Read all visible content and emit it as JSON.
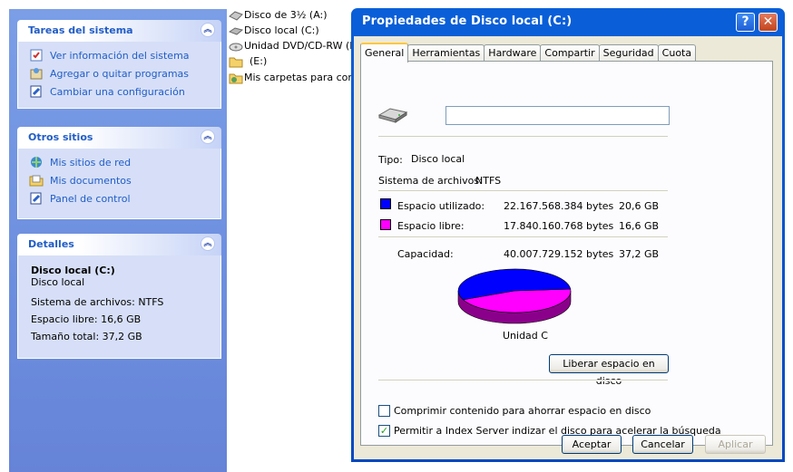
{
  "task_pane": {
    "system_tasks": {
      "title": "Tareas del sistema",
      "items": [
        {
          "label": "Ver información del sistema",
          "icon": "info-icon"
        },
        {
          "label": "Agregar o quitar programas",
          "icon": "add-remove-programs-icon"
        },
        {
          "label": "Cambiar una configuración",
          "icon": "control-panel-icon"
        }
      ]
    },
    "other_places": {
      "title": "Otros sitios",
      "items": [
        {
          "label": "Mis sitios de red",
          "icon": "network-icon"
        },
        {
          "label": "Mis documentos",
          "icon": "documents-folder-icon"
        },
        {
          "label": "Panel de control",
          "icon": "control-panel-icon"
        }
      ]
    },
    "details": {
      "title": "Detalles",
      "name": "Disco local (C:)",
      "type": "Disco local",
      "filesystem": "Sistema de archivos: NTFS",
      "free": "Espacio libre: 16,6 GB",
      "total": "Tamaño total: 37,2 GB"
    }
  },
  "files": [
    {
      "label": "Disco de 3½ (A:)",
      "icon": "floppy-drive-icon"
    },
    {
      "label": "Disco local (C:)",
      "icon": "hard-drive-icon"
    },
    {
      "label": "Unidad DVD/CD-RW (D:)",
      "icon": "cd-drive-icon"
    },
    {
      "label": "(E:)",
      "icon": "folder-icon"
    },
    {
      "label": "Mis carpetas para compar",
      "icon": "shared-folder-icon"
    }
  ],
  "dialog": {
    "title": "Propiedades de Disco local (C:)",
    "tabs": [
      "General",
      "Herramientas",
      "Hardware",
      "Compartir",
      "Seguridad",
      "Cuota"
    ],
    "active_tab": "General",
    "volume_name_value": "",
    "type_label": "Tipo:",
    "type_value": "Disco local",
    "fs_label": "Sistema de archivos:",
    "fs_value": "NTFS",
    "used": {
      "label": "Espacio utilizado:",
      "bytes": "22.167.568.384 bytes",
      "gb": "20,6 GB",
      "color": "#0000ff"
    },
    "free": {
      "label": "Espacio libre:",
      "bytes": "17.840.160.768 bytes",
      "gb": "16,6 GB",
      "color": "#ff00ff"
    },
    "capacity": {
      "label": "Capacidad:",
      "bytes": "40.007.729.152 bytes",
      "gb": "37,2 GB"
    },
    "drive_label": "Unidad C",
    "cleanup_button": "Liberar espacio en disco",
    "compress_label": "Comprimir contenido para ahorrar espacio en disco",
    "compress_checked": false,
    "index_label": "Permitir a Index Server indizar el disco para acelerar la búsqueda",
    "index_checked": true,
    "ok_button": "Aceptar",
    "cancel_button": "Cancelar",
    "apply_button": "Aplicar",
    "help_glyph": "?",
    "close_glyph": "✕"
  }
}
